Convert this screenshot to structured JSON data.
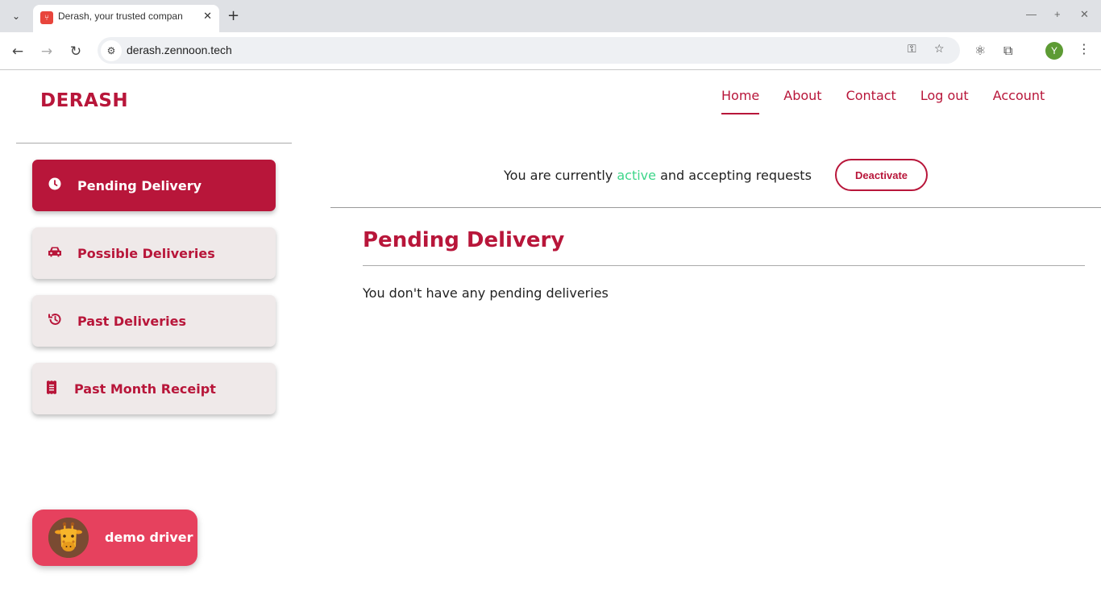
{
  "browser": {
    "tab_title": "Derash, your trusted compan",
    "url": "derash.zennoon.tech",
    "profile_initial": "Y",
    "icons": [
      "tab-search-icon",
      "close-icon",
      "new-tab-icon",
      "back-icon",
      "forward-icon",
      "reload-icon",
      "site-info-icon",
      "key-icon",
      "star-icon",
      "extension-icon",
      "puzzle-icon",
      "menu-icon"
    ]
  },
  "header": {
    "logo": "DERASH",
    "nav": [
      {
        "label": "Home",
        "active": true
      },
      {
        "label": "About"
      },
      {
        "label": "Contact"
      },
      {
        "label": "Log out"
      },
      {
        "label": "Account"
      }
    ]
  },
  "sidebar": {
    "items": [
      {
        "label": "Pending Delivery",
        "icon": "clock-icon",
        "active": true
      },
      {
        "label": "Possible Deliveries",
        "icon": "car-icon"
      },
      {
        "label": "Past Deliveries",
        "icon": "history-icon"
      },
      {
        "label": "Past Month Receipt",
        "icon": "receipt-icon"
      }
    ],
    "user": {
      "name": "demo driver",
      "avatar": "giraffe-avatar"
    }
  },
  "status": {
    "prefix": "You are currently ",
    "state": "active",
    "suffix": " and accepting requests",
    "state_color": "#3ed68a",
    "button_label": "Deactivate"
  },
  "main": {
    "title": "Pending Delivery",
    "empty_message": "You don't have any pending deliveries"
  },
  "colors": {
    "brand": "#b8163a",
    "chip": "#e6415e"
  }
}
